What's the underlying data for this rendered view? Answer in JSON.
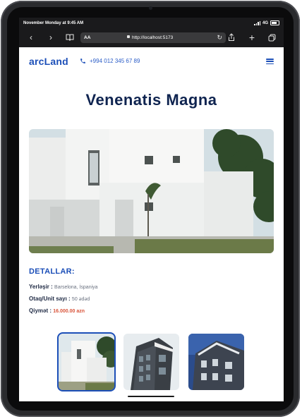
{
  "status": {
    "time": "November Monday at 9:45 AM",
    "network": "4G"
  },
  "browser": {
    "text_size_label": "AA",
    "url": "http://localhost:5173"
  },
  "header": {
    "logo": "arcLand",
    "phone": "+994 012 345 67 89"
  },
  "property": {
    "title": "Venenatis Magna",
    "details_heading": "DETALLAR:",
    "location_label": "Yerləşir :",
    "location_value": "Barselona, İspaniya",
    "units_label": "Otaq/Unit sayı :",
    "units_value": "50 ədəd",
    "price_label": "Qiymət :",
    "price_value": "16.000.00 azn"
  },
  "colors": {
    "brand": "#1c4fb8",
    "title": "#0f2450",
    "price": "#d9543a"
  }
}
